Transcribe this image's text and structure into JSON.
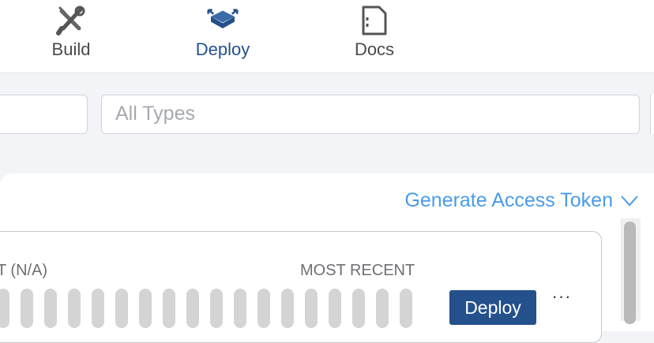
{
  "nav": {
    "tabs": [
      {
        "label": "Build",
        "icon": "wrench-screwdriver-icon",
        "active": false
      },
      {
        "label": "Deploy",
        "icon": "deploy-box-icon",
        "active": true
      },
      {
        "label": "Docs",
        "icon": "document-icon",
        "active": false
      }
    ]
  },
  "filters": {
    "first_value": "",
    "types_placeholder": "All Types"
  },
  "panel": {
    "generate_token_label": "Generate Access Token",
    "columns": {
      "status_label": "T (N/A)",
      "most_recent_label": "MOST RECENT"
    },
    "deploy_label": "Deploy",
    "more_label": "···"
  },
  "colors": {
    "primary": "#24508c",
    "link": "#4a9be8",
    "bar": "#d4d4d4",
    "background": "#f3f4f8"
  }
}
